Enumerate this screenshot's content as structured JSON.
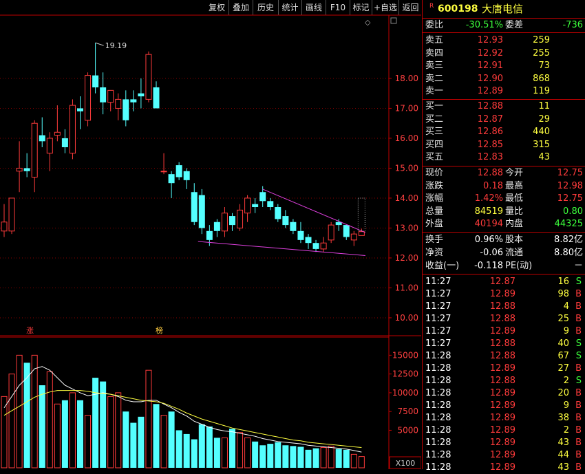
{
  "toolbar": {
    "buttons": [
      "复权",
      "叠加",
      "历史",
      "统计",
      "画线",
      "F10",
      "标记",
      "+自选",
      "返回"
    ]
  },
  "stock": {
    "badge": "R",
    "code": "600198",
    "name": "大唐电信"
  },
  "order_ratio": {
    "label1": "委比",
    "value1": "-30.51%",
    "label2": "委差",
    "value2": "-736"
  },
  "asks": [
    {
      "label": "卖五",
      "price": "12.93",
      "vol": "259"
    },
    {
      "label": "卖四",
      "price": "12.92",
      "vol": "255"
    },
    {
      "label": "卖三",
      "price": "12.91",
      "vol": "73"
    },
    {
      "label": "卖二",
      "price": "12.90",
      "vol": "868"
    },
    {
      "label": "卖一",
      "price": "12.89",
      "vol": "119"
    }
  ],
  "bids": [
    {
      "label": "买一",
      "price": "12.88",
      "vol": "11"
    },
    {
      "label": "买二",
      "price": "12.87",
      "vol": "29"
    },
    {
      "label": "买三",
      "price": "12.86",
      "vol": "440"
    },
    {
      "label": "买四",
      "price": "12.85",
      "vol": "315"
    },
    {
      "label": "买五",
      "price": "12.83",
      "vol": "43"
    }
  ],
  "quote": [
    {
      "l1": "现价",
      "v1": "12.88",
      "c1": "red",
      "l2": "今开",
      "v2": "12.75",
      "c2": "red"
    },
    {
      "l1": "涨跌",
      "v1": "0.18",
      "c1": "red",
      "l2": "最高",
      "v2": "12.98",
      "c2": "red"
    },
    {
      "l1": "涨幅",
      "v1": "1.42%",
      "c1": "red",
      "l2": "最低",
      "v2": "12.75",
      "c2": "red"
    },
    {
      "l1": "总量",
      "v1": "84519",
      "c1": "yel",
      "l2": "量比",
      "v2": "0.80",
      "c2": "green"
    },
    {
      "l1": "外盘",
      "v1": "40194",
      "c1": "red",
      "l2": "内盘",
      "v2": "44325",
      "c2": "green"
    }
  ],
  "fundamentals": [
    {
      "l1": "换手",
      "v1": "0.96%",
      "l2": "股本",
      "v2": "8.82亿"
    },
    {
      "l1": "净资",
      "v1": "-0.06",
      "l2": "流通",
      "v2": "8.80亿"
    },
    {
      "l1": "收益(一)",
      "v1": "-0.118",
      "l2": "PE(动)",
      "v2": "－"
    }
  ],
  "ticks": [
    {
      "time": "11:27",
      "price": "12.87",
      "vol": "16",
      "side": "S"
    },
    {
      "time": "11:27",
      "price": "12.89",
      "vol": "98",
      "side": "B"
    },
    {
      "time": "11:27",
      "price": "12.88",
      "vol": "4",
      "side": "B"
    },
    {
      "time": "11:27",
      "price": "12.88",
      "vol": "25",
      "side": "B"
    },
    {
      "time": "11:27",
      "price": "12.89",
      "vol": "9",
      "side": "B"
    },
    {
      "time": "11:27",
      "price": "12.88",
      "vol": "40",
      "side": "S"
    },
    {
      "time": "11:28",
      "price": "12.88",
      "vol": "67",
      "side": "S"
    },
    {
      "time": "11:28",
      "price": "12.89",
      "vol": "27",
      "side": "B"
    },
    {
      "time": "11:28",
      "price": "12.88",
      "vol": "2",
      "side": "S"
    },
    {
      "time": "11:28",
      "price": "12.89",
      "vol": "20",
      "side": "B"
    },
    {
      "time": "11:28",
      "price": "12.89",
      "vol": "9",
      "side": "B"
    },
    {
      "time": "11:28",
      "price": "12.89",
      "vol": "38",
      "side": "B"
    },
    {
      "time": "11:28",
      "price": "12.89",
      "vol": "2",
      "side": "B"
    },
    {
      "time": "11:28",
      "price": "12.89",
      "vol": "43",
      "side": "B"
    },
    {
      "time": "11:28",
      "price": "12.89",
      "vol": "44",
      "side": "B"
    },
    {
      "time": "11:28",
      "price": "12.89",
      "vol": "43",
      "side": "B"
    }
  ],
  "chart_data": [
    {
      "type": "candlestick",
      "title": "",
      "ylim": [
        9.7,
        19.7
      ],
      "y_ticks": [
        "18.00",
        "17.00",
        "16.00",
        "15.00",
        "14.00",
        "13.00",
        "12.00",
        "11.00",
        "10.00"
      ],
      "max_annotation": "19.19",
      "markers": [
        "涨",
        "榜"
      ],
      "candles": [
        {
          "o": 12.9,
          "h": 13.8,
          "l": 12.7,
          "c": 13.2
        },
        {
          "o": 12.9,
          "h": 14.0,
          "l": 12.8,
          "c": 14.0
        },
        {
          "o": 14.9,
          "h": 15.9,
          "l": 14.2,
          "c": 15.0
        },
        {
          "o": 15.0,
          "h": 15.5,
          "l": 14.7,
          "c": 14.9
        },
        {
          "o": 14.7,
          "h": 16.6,
          "l": 14.2,
          "c": 16.5
        },
        {
          "o": 16.1,
          "h": 16.7,
          "l": 15.7,
          "c": 15.9
        },
        {
          "o": 15.5,
          "h": 16.2,
          "l": 14.9,
          "c": 16.0
        },
        {
          "o": 16.1,
          "h": 17.1,
          "l": 15.9,
          "c": 16.2
        },
        {
          "o": 16.0,
          "h": 16.3,
          "l": 15.5,
          "c": 15.7
        },
        {
          "o": 15.5,
          "h": 17.3,
          "l": 15.3,
          "c": 17.1
        },
        {
          "o": 17.0,
          "h": 17.4,
          "l": 16.3,
          "c": 16.9
        },
        {
          "o": 16.6,
          "h": 18.2,
          "l": 16.4,
          "c": 18.1
        },
        {
          "o": 18.1,
          "h": 19.19,
          "l": 17.5,
          "c": 17.7
        },
        {
          "o": 17.7,
          "h": 18.2,
          "l": 16.8,
          "c": 17.2
        },
        {
          "o": 17.2,
          "h": 17.6,
          "l": 16.9,
          "c": 17.6
        },
        {
          "o": 17.0,
          "h": 17.5,
          "l": 16.6,
          "c": 17.3
        },
        {
          "o": 17.3,
          "h": 17.6,
          "l": 16.4,
          "c": 16.6
        },
        {
          "o": 17.3,
          "h": 17.6,
          "l": 16.9,
          "c": 17.2
        },
        {
          "o": 17.5,
          "h": 18.0,
          "l": 17.0,
          "c": 17.4
        },
        {
          "o": 17.3,
          "h": 18.9,
          "l": 17.2,
          "c": 18.8
        },
        {
          "o": 17.7,
          "h": 17.9,
          "l": 17.0,
          "c": 17.0
        },
        {
          "o": 14.9,
          "h": 15.5,
          "l": 14.8,
          "c": 14.9
        },
        {
          "o": 14.8,
          "h": 14.9,
          "l": 14.0,
          "c": 14.5
        },
        {
          "o": 15.1,
          "h": 15.2,
          "l": 14.6,
          "c": 14.7
        },
        {
          "o": 14.9,
          "h": 15.0,
          "l": 14.3,
          "c": 14.6
        },
        {
          "o": 14.2,
          "h": 14.5,
          "l": 13.1,
          "c": 13.2
        },
        {
          "o": 14.1,
          "h": 14.3,
          "l": 12.8,
          "c": 13.0
        },
        {
          "o": 12.9,
          "h": 13.1,
          "l": 12.4,
          "c": 12.6
        },
        {
          "o": 13.2,
          "h": 13.3,
          "l": 12.7,
          "c": 12.9
        },
        {
          "o": 12.9,
          "h": 13.7,
          "l": 12.7,
          "c": 13.5
        },
        {
          "o": 13.4,
          "h": 13.5,
          "l": 12.9,
          "c": 13.1
        },
        {
          "o": 13.0,
          "h": 13.8,
          "l": 12.9,
          "c": 13.6
        },
        {
          "o": 13.5,
          "h": 14.1,
          "l": 13.2,
          "c": 14.0
        },
        {
          "o": 13.8,
          "h": 14.0,
          "l": 13.5,
          "c": 13.7
        },
        {
          "o": 14.2,
          "h": 14.4,
          "l": 13.7,
          "c": 13.9
        },
        {
          "o": 13.9,
          "h": 14.0,
          "l": 13.6,
          "c": 13.7
        },
        {
          "o": 13.7,
          "h": 13.8,
          "l": 13.2,
          "c": 13.3
        },
        {
          "o": 13.4,
          "h": 13.6,
          "l": 13.0,
          "c": 13.1
        },
        {
          "o": 13.2,
          "h": 13.3,
          "l": 12.8,
          "c": 12.9
        },
        {
          "o": 12.9,
          "h": 13.2,
          "l": 12.5,
          "c": 12.6
        },
        {
          "o": 12.7,
          "h": 12.8,
          "l": 12.3,
          "c": 12.5
        },
        {
          "o": 12.5,
          "h": 12.6,
          "l": 12.2,
          "c": 12.3
        },
        {
          "o": 12.3,
          "h": 12.7,
          "l": 12.2,
          "c": 12.5
        },
        {
          "o": 12.6,
          "h": 13.2,
          "l": 12.5,
          "c": 13.1
        },
        {
          "o": 13.2,
          "h": 13.3,
          "l": 12.9,
          "c": 13.1
        },
        {
          "o": 13.1,
          "h": 13.1,
          "l": 12.6,
          "c": 12.7
        },
        {
          "o": 12.6,
          "h": 12.9,
          "l": 12.4,
          "c": 12.8
        },
        {
          "o": 12.75,
          "h": 12.98,
          "l": 12.75,
          "c": 12.88
        }
      ],
      "trendlines": [
        {
          "from": [
            "idx",
            25.5,
            12.55
          ],
          "to": [
            "idx",
            47.5,
            12.08
          ]
        },
        {
          "from": [
            "idx",
            34,
            14.3
          ],
          "to": [
            "idx",
            47.5,
            12.85
          ]
        }
      ]
    },
    {
      "type": "bar",
      "title": "",
      "unit": "X100",
      "ylim": [
        0,
        16500
      ],
      "y_ticks": [
        "15000",
        "12500",
        "10000",
        "7500",
        "5000"
      ],
      "volumes": [
        9500,
        12500,
        15000,
        14000,
        15000,
        11000,
        12800,
        8500,
        9000,
        10000,
        9000,
        7000,
        12000,
        11500,
        9500,
        10000,
        7500,
        6000,
        6800,
        13000,
        8500,
        7000,
        7500,
        5000,
        4500,
        3800,
        5800,
        5500,
        4000,
        4000,
        5200,
        4700,
        4000,
        3500,
        3000,
        3200,
        3400,
        3000,
        2900,
        2800,
        2400,
        2600,
        2700,
        2900,
        2500,
        2400,
        1800,
        1500
      ],
      "ma_lines": [
        {
          "name": "MA5",
          "color": "#ffffff",
          "values": [
            8000,
            9500,
            11000,
            12000,
            13200,
            13500,
            13000,
            12000,
            11000,
            10500,
            10000,
            9600,
            9800,
            10000,
            9800,
            9500,
            9000,
            8800,
            8800,
            9000,
            9000,
            8500,
            8000,
            7400,
            6900,
            6200,
            5800,
            5400,
            5100,
            4900,
            4800,
            4600,
            4400,
            4200,
            3900,
            3700,
            3500,
            3400,
            3300,
            3200,
            3000,
            2900,
            2800,
            2700,
            2600,
            2500,
            2300,
            2100
          ]
        },
        {
          "name": "MA10",
          "color": "#ffff40",
          "values": [
            7000,
            7600,
            8200,
            8800,
            9400,
            9800,
            10100,
            10300,
            10300,
            10300,
            10300,
            10200,
            10000,
            9900,
            9800,
            9600,
            9400,
            9200,
            9000,
            8900,
            8800,
            8600,
            8200,
            7800,
            7300,
            6900,
            6500,
            6200,
            5900,
            5600,
            5300,
            5100,
            4900,
            4700,
            4500,
            4300,
            4100,
            3900,
            3700,
            3600,
            3400,
            3300,
            3200,
            3100,
            3000,
            2900,
            2800,
            2700
          ]
        }
      ]
    }
  ]
}
